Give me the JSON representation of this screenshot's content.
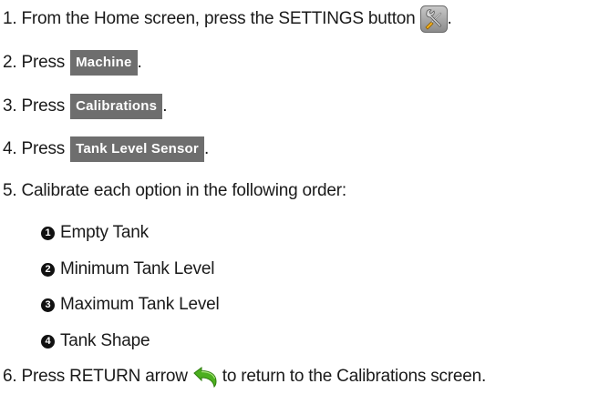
{
  "steps": [
    {
      "before": "1. From the Home screen, press the SETTINGS button",
      "after": "."
    },
    {
      "before": "2. Press",
      "button": "Machine",
      "after": "."
    },
    {
      "before": "3. Press",
      "button": "Calibrations",
      "after": "."
    },
    {
      "before": "4. Press",
      "button": "Tank Level Sensor",
      "after": "."
    },
    {
      "before": "5. Calibrate each option in the following order:"
    },
    {
      "before": "6. Press RETURN arrow",
      "after": "to return to the Calibrations screen."
    }
  ],
  "suboptions": [
    {
      "badge": "1",
      "label": "Empty Tank"
    },
    {
      "badge": "2",
      "label": "Minimum Tank Level"
    },
    {
      "badge": "3",
      "label": "Maximum Tank Level"
    },
    {
      "badge": "4",
      "label": "Tank Shape"
    }
  ],
  "icons": {
    "settings": "settings-tools-icon",
    "return": "return-arrow-icon"
  },
  "colors": {
    "button_bg": "#6e6e6e",
    "button_text": "#ffffff",
    "text": "#1a1a1a",
    "return_arrow": "#4caf1f"
  }
}
